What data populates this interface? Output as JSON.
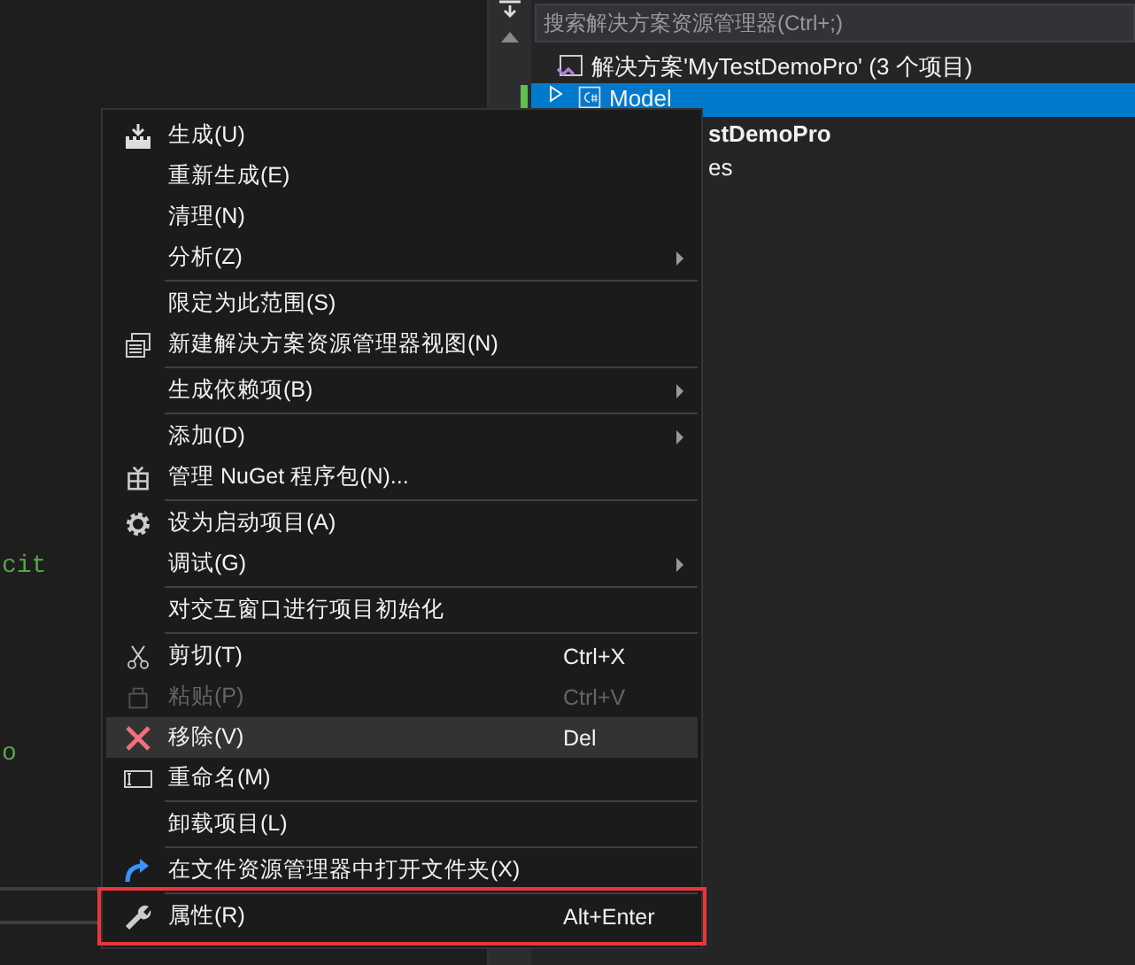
{
  "editor": {
    "code_lines": [
      "cit",
      "o"
    ]
  },
  "solution_explorer": {
    "search": {
      "placeholder": "搜索解决方案资源管理器(Ctrl+;)"
    },
    "tree": [
      {
        "label": "解决方案'MyTestDemoPro' (3 个项目)",
        "selected": false,
        "bold": false
      },
      {
        "label": "Model",
        "selected": true,
        "bold": false
      },
      {
        "label": "stDemoPro",
        "selected": false,
        "bold": true
      },
      {
        "label": "es",
        "selected": false,
        "bold": false
      }
    ]
  },
  "context_menu": {
    "groups": [
      [
        {
          "label": "生成(U)",
          "submenu": false,
          "disabled": false,
          "selected": false,
          "highlighted": false
        },
        {
          "label": "重新生成(E)",
          "submenu": false,
          "disabled": false,
          "selected": false,
          "highlighted": false
        },
        {
          "label": "清理(N)",
          "submenu": false,
          "disabled": false,
          "selected": false,
          "highlighted": false
        },
        {
          "label": "分析(Z)",
          "submenu": true,
          "disabled": false,
          "selected": false,
          "highlighted": false
        }
      ],
      [
        {
          "label": "限定为此范围(S)",
          "submenu": false,
          "disabled": false,
          "selected": false,
          "highlighted": false
        },
        {
          "label": "新建解决方案资源管理器视图(N)",
          "submenu": false,
          "disabled": false,
          "selected": false,
          "highlighted": false
        }
      ],
      [
        {
          "label": "生成依赖项(B)",
          "submenu": true,
          "disabled": false,
          "selected": false,
          "highlighted": false
        }
      ],
      [
        {
          "label": "添加(D)",
          "submenu": true,
          "disabled": false,
          "selected": false,
          "highlighted": false
        },
        {
          "label": "管理 NuGet 程序包(N)...",
          "submenu": false,
          "disabled": false,
          "selected": false,
          "highlighted": false
        }
      ],
      [
        {
          "label": "设为启动项目(A)",
          "submenu": false,
          "disabled": false,
          "selected": false,
          "highlighted": false
        },
        {
          "label": "调试(G)",
          "submenu": true,
          "disabled": false,
          "selected": false,
          "highlighted": false
        }
      ],
      [
        {
          "label": "对交互窗口进行项目初始化",
          "submenu": false,
          "disabled": false,
          "selected": false,
          "highlighted": false
        }
      ],
      [
        {
          "label": "剪切(T)",
          "shortcut": "Ctrl+X",
          "submenu": false,
          "disabled": false,
          "selected": false,
          "highlighted": false
        },
        {
          "label": "粘贴(P)",
          "shortcut": "Ctrl+V",
          "submenu": false,
          "disabled": true,
          "selected": false,
          "highlighted": false
        },
        {
          "label": "移除(V)",
          "shortcut": "Del",
          "submenu": false,
          "disabled": false,
          "selected": true,
          "highlighted": false
        },
        {
          "label": "重命名(M)",
          "submenu": false,
          "disabled": false,
          "selected": false,
          "highlighted": false
        }
      ],
      [
        {
          "label": "卸载项目(L)",
          "submenu": false,
          "disabled": false,
          "selected": false,
          "highlighted": false
        }
      ],
      [
        {
          "label": "在文件资源管理器中打开文件夹(X)",
          "submenu": false,
          "disabled": false,
          "selected": false,
          "highlighted": false
        }
      ],
      [
        {
          "label": "属性(R)",
          "shortcut": "Alt+Enter",
          "submenu": false,
          "disabled": false,
          "selected": false,
          "highlighted": true
        }
      ]
    ]
  }
}
